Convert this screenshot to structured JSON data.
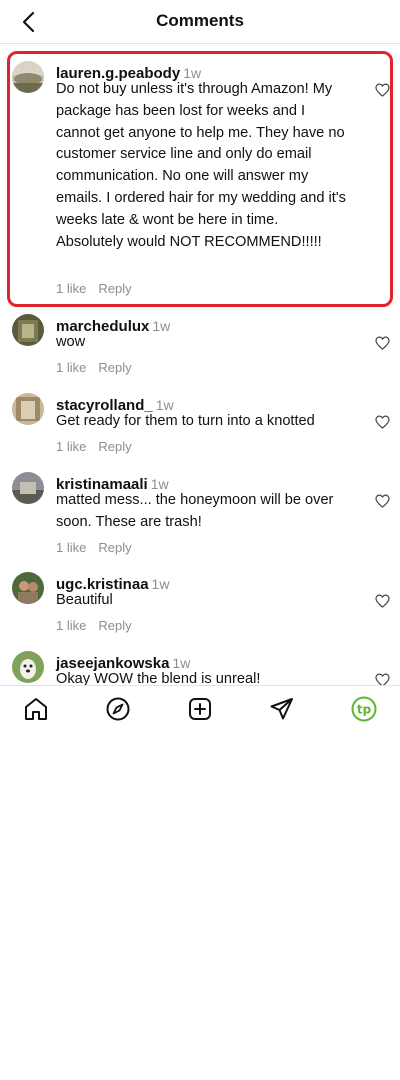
{
  "header": {
    "title": "Comments"
  },
  "comments": [
    {
      "username": "lauren.g.peabody",
      "time": "1w",
      "text": "Do not buy unless it's through Amazon! My package has been lost for weeks and I cannot get anyone to help me. They have no customer service line and only do email communication. No one will answer my emails. I ordered hair for my wedding and it's weeks late & wont be here in time. Absolutely would NOT RECOMMEND!!!!!",
      "likes": "1 like",
      "reply": "Reply"
    },
    {
      "username": "marchedulux",
      "time": "1w",
      "text": "wow",
      "likes": "1 like",
      "reply": "Reply"
    },
    {
      "username": "stacyrolland_",
      "time": "1w",
      "text": "Get ready for them to turn into a knotted",
      "likes": "1 like",
      "reply": "Reply"
    },
    {
      "username": "kristinamaali",
      "time": "1w",
      "text": "matted mess... the honeymoon will be over soon. These are trash!",
      "likes": "1 like",
      "reply": "Reply"
    },
    {
      "username": "ugc.kristinaa",
      "time": "1w",
      "text": "Beautiful ⁡",
      "likes": "1 like",
      "reply": "Reply"
    },
    {
      "username": "jaseejankowska",
      "time": "1w",
      "text": "Okay WOW the blend is unreal!"
    }
  ],
  "tabbar": {
    "icons": [
      "home-icon",
      "explore-icon",
      "create-icon",
      "direct-message-icon",
      "profile-avatar"
    ],
    "profile_initials": "tp",
    "accent": "#5cb82e"
  },
  "highlight_color": "#e0242f"
}
